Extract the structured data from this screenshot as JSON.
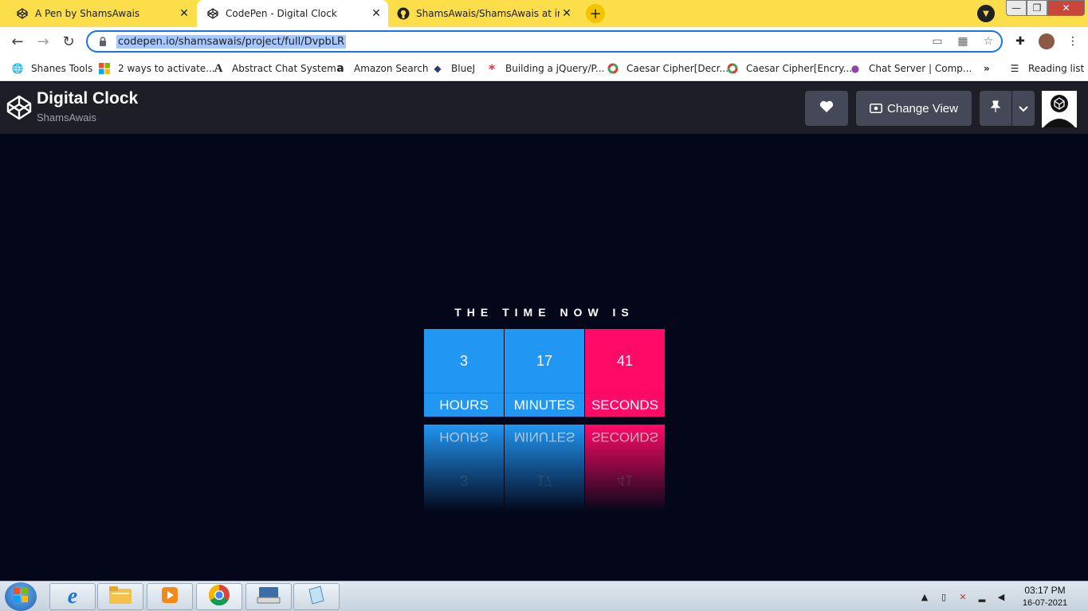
{
  "browser": {
    "tabs": [
      {
        "title": "A Pen by ShamsAwais",
        "icon": "codepen-icon"
      },
      {
        "title": "CodePen - Digital Clock",
        "icon": "codepen-icon"
      },
      {
        "title": "ShamsAwais/ShamsAwais at imag",
        "icon": "github-icon"
      }
    ],
    "url": "codepen.io/shamsawais/project/full/DvpbLR",
    "bookmarks": [
      {
        "label": "Shanes Tools",
        "icon": "globe-icon"
      },
      {
        "label": "2 ways to activate...",
        "icon": "microsoft-icon"
      },
      {
        "label": "Abstract Chat System",
        "icon": "font-icon"
      },
      {
        "label": "Amazon Search",
        "icon": "amazon-icon"
      },
      {
        "label": "BlueJ",
        "icon": "bluej-icon"
      },
      {
        "label": "Building a jQuery/P...",
        "icon": "asterisk-icon"
      },
      {
        "label": "Caesar Cipher[Decr...",
        "icon": "ring-icon"
      },
      {
        "label": "Caesar Cipher[Encry...",
        "icon": "ring-icon"
      },
      {
        "label": "Chat Server | Comp...",
        "icon": "chat-icon"
      }
    ],
    "more_bookmarks": "»",
    "reading_list": "Reading list"
  },
  "codepen": {
    "title": "Digital Clock",
    "author": "ShamsAwais",
    "change_view": "Change View"
  },
  "clock": {
    "heading": "THE TIME NOW IS",
    "hours": "3",
    "minutes": "17",
    "seconds": "41",
    "hours_label": "HOURS",
    "minutes_label": "MINUTES",
    "seconds_label": "SECONDS",
    "colors": {
      "blue": "#2196f3",
      "pink": "#ff0a66",
      "background": "#030719"
    }
  },
  "taskbar": {
    "time": "03:17 PM",
    "date": "16-07-2021"
  }
}
